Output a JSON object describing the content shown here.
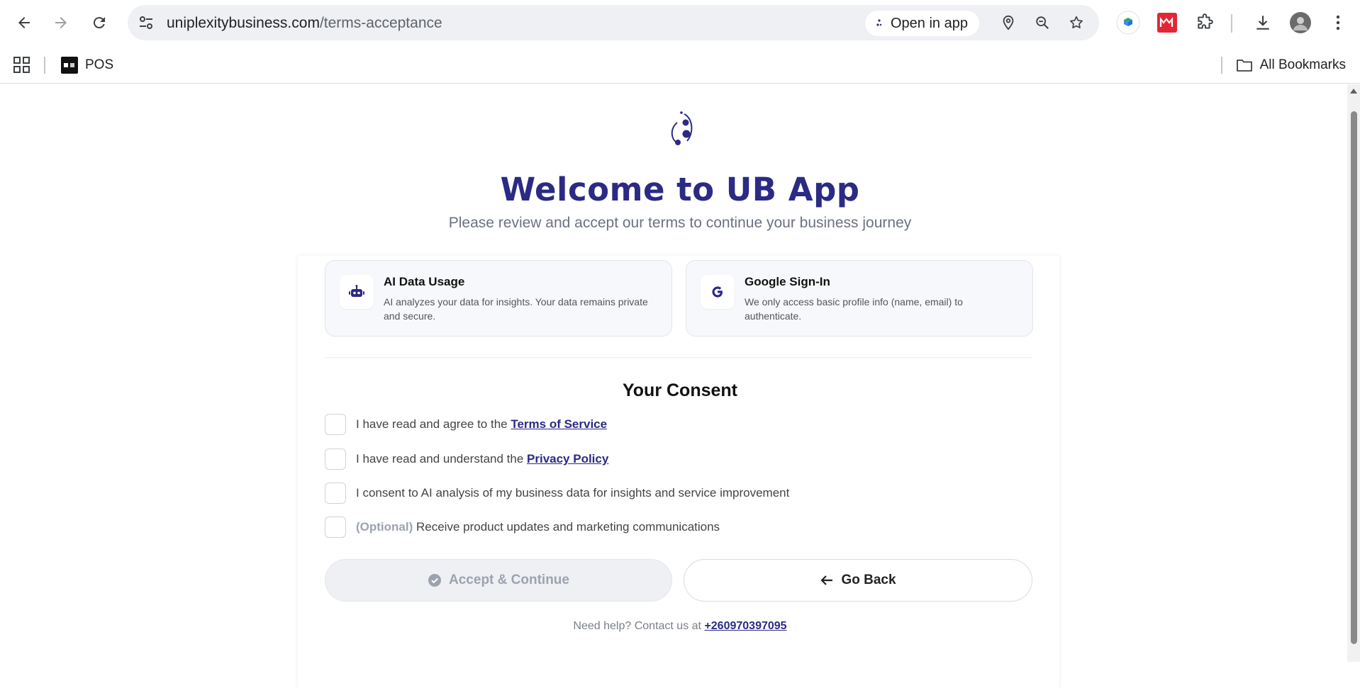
{
  "browser": {
    "url_domain": "uniplexitybusiness.com",
    "url_path": "/terms-acceptance",
    "open_in_app_label": "Open in app",
    "bookmark_pos_label": "POS",
    "all_bookmarks_label": "All Bookmarks"
  },
  "page": {
    "title": "Welcome to UB App",
    "subtitle": "Please review and accept our terms to continue your business journey",
    "cards": [
      {
        "icon": "robot-icon",
        "title": "AI Data Usage",
        "description": "AI analyzes your data for insights. Your data remains private and secure."
      },
      {
        "icon": "google-icon",
        "title": "Google Sign-In",
        "description": "We only access basic profile info (name, email) to authenticate."
      }
    ],
    "consent_title": "Your Consent",
    "consents": [
      {
        "prefix": "I have read and agree to the ",
        "link": "Terms of Service",
        "checked": false
      },
      {
        "prefix": "I have read and understand the ",
        "link": "Privacy Policy",
        "checked": false
      },
      {
        "prefix": "I consent to AI analysis of my business data for insights and service improvement",
        "checked": false
      },
      {
        "optional_tag": "(Optional)",
        "prefix": " Receive product updates and marketing communications",
        "checked": false
      }
    ],
    "accept_label": "Accept & Continue",
    "back_label": "Go Back",
    "help_prefix": "Need help? Contact us at ",
    "help_phone": "+260970397095"
  },
  "colors": {
    "brand": "#2b2a85",
    "muted": "#6b7280",
    "disabled": "#9ca3af"
  }
}
